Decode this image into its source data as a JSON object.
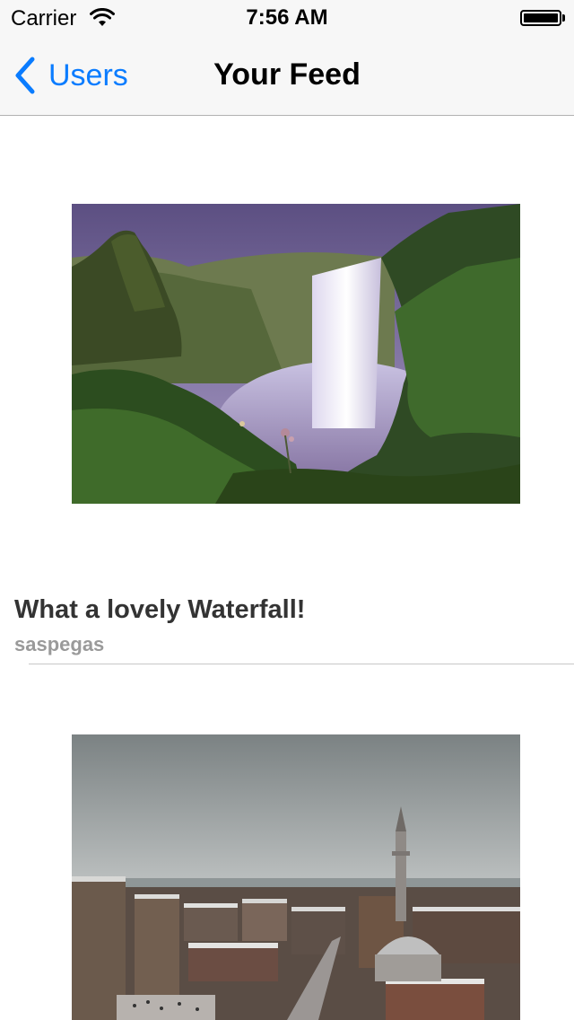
{
  "status_bar": {
    "carrier": "Carrier",
    "time": "7:56 AM",
    "wifi_icon": "wifi-icon",
    "battery_icon": "battery-full-icon"
  },
  "nav_bar": {
    "back_label": "Users",
    "back_icon": "chevron-left-icon",
    "title": "Your Feed",
    "accent_color": "#0a7cff"
  },
  "feed": {
    "posts": [
      {
        "image_description": "waterfall",
        "title": "What a lovely Waterfall!",
        "username": "saspegas"
      },
      {
        "image_description": "snowy city with mosque"
      }
    ]
  }
}
